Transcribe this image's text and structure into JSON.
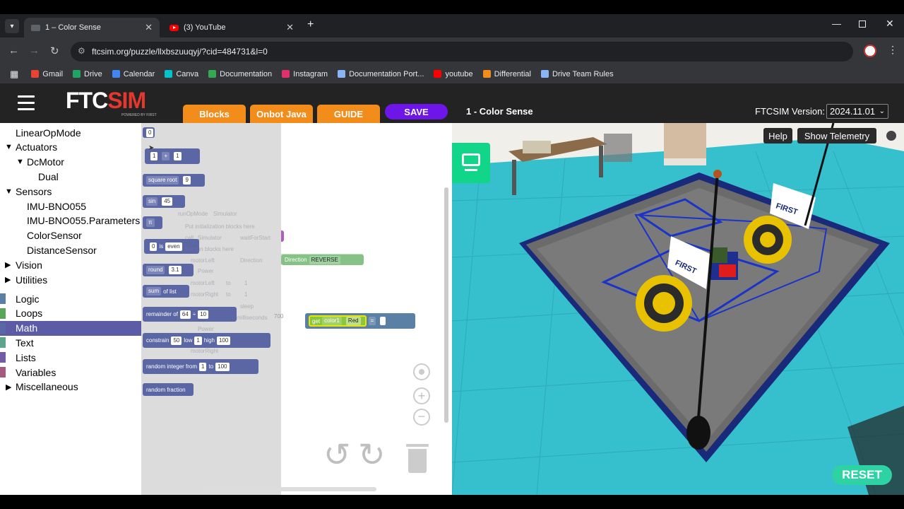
{
  "browser": {
    "tabs": [
      {
        "title": "1 – Color Sense"
      },
      {
        "title": "(3) YouTube"
      }
    ],
    "url": "ftcsim.org/puzzle/llxbszuuqyj/?cid=484731&l=0",
    "bookmarks": [
      "Gmail",
      "Drive",
      "Calendar",
      "Canva",
      "Documentation",
      "Instagram",
      "Documentation Port...",
      "youtube",
      "Differential",
      "Drive Team Rules"
    ],
    "bookmark_colors": [
      "#ea4335",
      "#1fa463",
      "#4285f4",
      "#00c4cc",
      "#34a853",
      "#e1306c",
      "#8ab4f8",
      "#ff0000",
      "#f28d1b",
      "#8ab4f8"
    ]
  },
  "app": {
    "logo_main": "FTC",
    "logo_accent": "SIM",
    "logo_sub": "POWERED BY FIRST",
    "tabs": [
      "Blocks",
      "Onbot Java",
      "GUIDE"
    ],
    "save_label": "SAVE",
    "puzzle_title": "1 - Color Sense",
    "version_label": "FTCSIM Version:",
    "version_value": "2024.11.01",
    "brand_colors": {
      "orange": "#f28d1b",
      "purple": "#6e15ea",
      "reset": "#2ed3a4"
    }
  },
  "toolbox": {
    "items": [
      {
        "label": "LinearOpMode",
        "indent": 0,
        "arrow": ""
      },
      {
        "label": "Actuators",
        "indent": 0,
        "arrow": "down"
      },
      {
        "label": "DcMotor",
        "indent": 1,
        "arrow": "down"
      },
      {
        "label": "Dual",
        "indent": 2,
        "arrow": ""
      },
      {
        "label": "Sensors",
        "indent": 0,
        "arrow": "down"
      },
      {
        "label": "IMU-BNO055",
        "indent": 1,
        "arrow": ""
      },
      {
        "label": "IMU-BNO055.Parameters",
        "indent": 1,
        "arrow": ""
      },
      {
        "label": "ColorSensor",
        "indent": 1,
        "arrow": ""
      },
      {
        "label": "DistanceSensor",
        "indent": 1,
        "arrow": ""
      },
      {
        "label": "Vision",
        "indent": 0,
        "arrow": "right"
      },
      {
        "label": "Utilities",
        "indent": 0,
        "arrow": "right"
      }
    ],
    "categories": [
      {
        "label": "Logic",
        "color": "#5b80a5"
      },
      {
        "label": "Loops",
        "color": "#5ba55b"
      },
      {
        "label": "Math",
        "color": "#5b67a5",
        "selected": true
      },
      {
        "label": "Text",
        "color": "#5ba58c"
      },
      {
        "label": "Lists",
        "color": "#745ba5"
      },
      {
        "label": "Variables",
        "color": "#a55b80"
      },
      {
        "label": "Miscellaneous",
        "color": "#ffffff",
        "arrow": "right"
      }
    ]
  },
  "flyout": {
    "number": "0",
    "arith": {
      "a": "1",
      "op": "+",
      "b": "1"
    },
    "sqrt": {
      "label": "square root",
      "val": "9"
    },
    "sin": {
      "label": "sin",
      "val": "45"
    },
    "pi": "π",
    "even": {
      "val": "0",
      "is": "is",
      "prop": "even"
    },
    "round": {
      "label": "round",
      "val": "3.1"
    },
    "sum": {
      "label": "sum",
      "of": "of list"
    },
    "remainder": {
      "label": "remainder of",
      "a": "64",
      "div": "÷",
      "b": "10"
    },
    "constrain": {
      "label": "constrain",
      "val": "50",
      "low": "low",
      "lowv": "1",
      "high": "high",
      "highv": "100"
    },
    "randint": {
      "label": "random integer from",
      "a": "1",
      "to": "to",
      "b": "100"
    },
    "randfrac": "random fraction"
  },
  "workspace": {
    "ghost_lines": [
      "runOpMode",
      "Simulator",
      "Put initialization blocks here",
      "call",
      "Simulator",
      "waitForStart",
      "Put run blocks here",
      "motorLeft",
      "Direction",
      "Power",
      "motorLeft",
      "to",
      "1",
      "motorRight",
      "to",
      "1",
      "sleep",
      "milliseconds",
      "Power",
      "motorRight"
    ],
    "direction_block": {
      "label": "Direction",
      "value": "REVERSE"
    },
    "get_block": {
      "get": "get",
      "var": "color1",
      "color": "Red",
      "op": "="
    },
    "ghost_700": "700"
  },
  "sim": {
    "help": "Help",
    "telemetry": "Show Telemetry",
    "reset": "RESET",
    "banner": "FIRST"
  }
}
